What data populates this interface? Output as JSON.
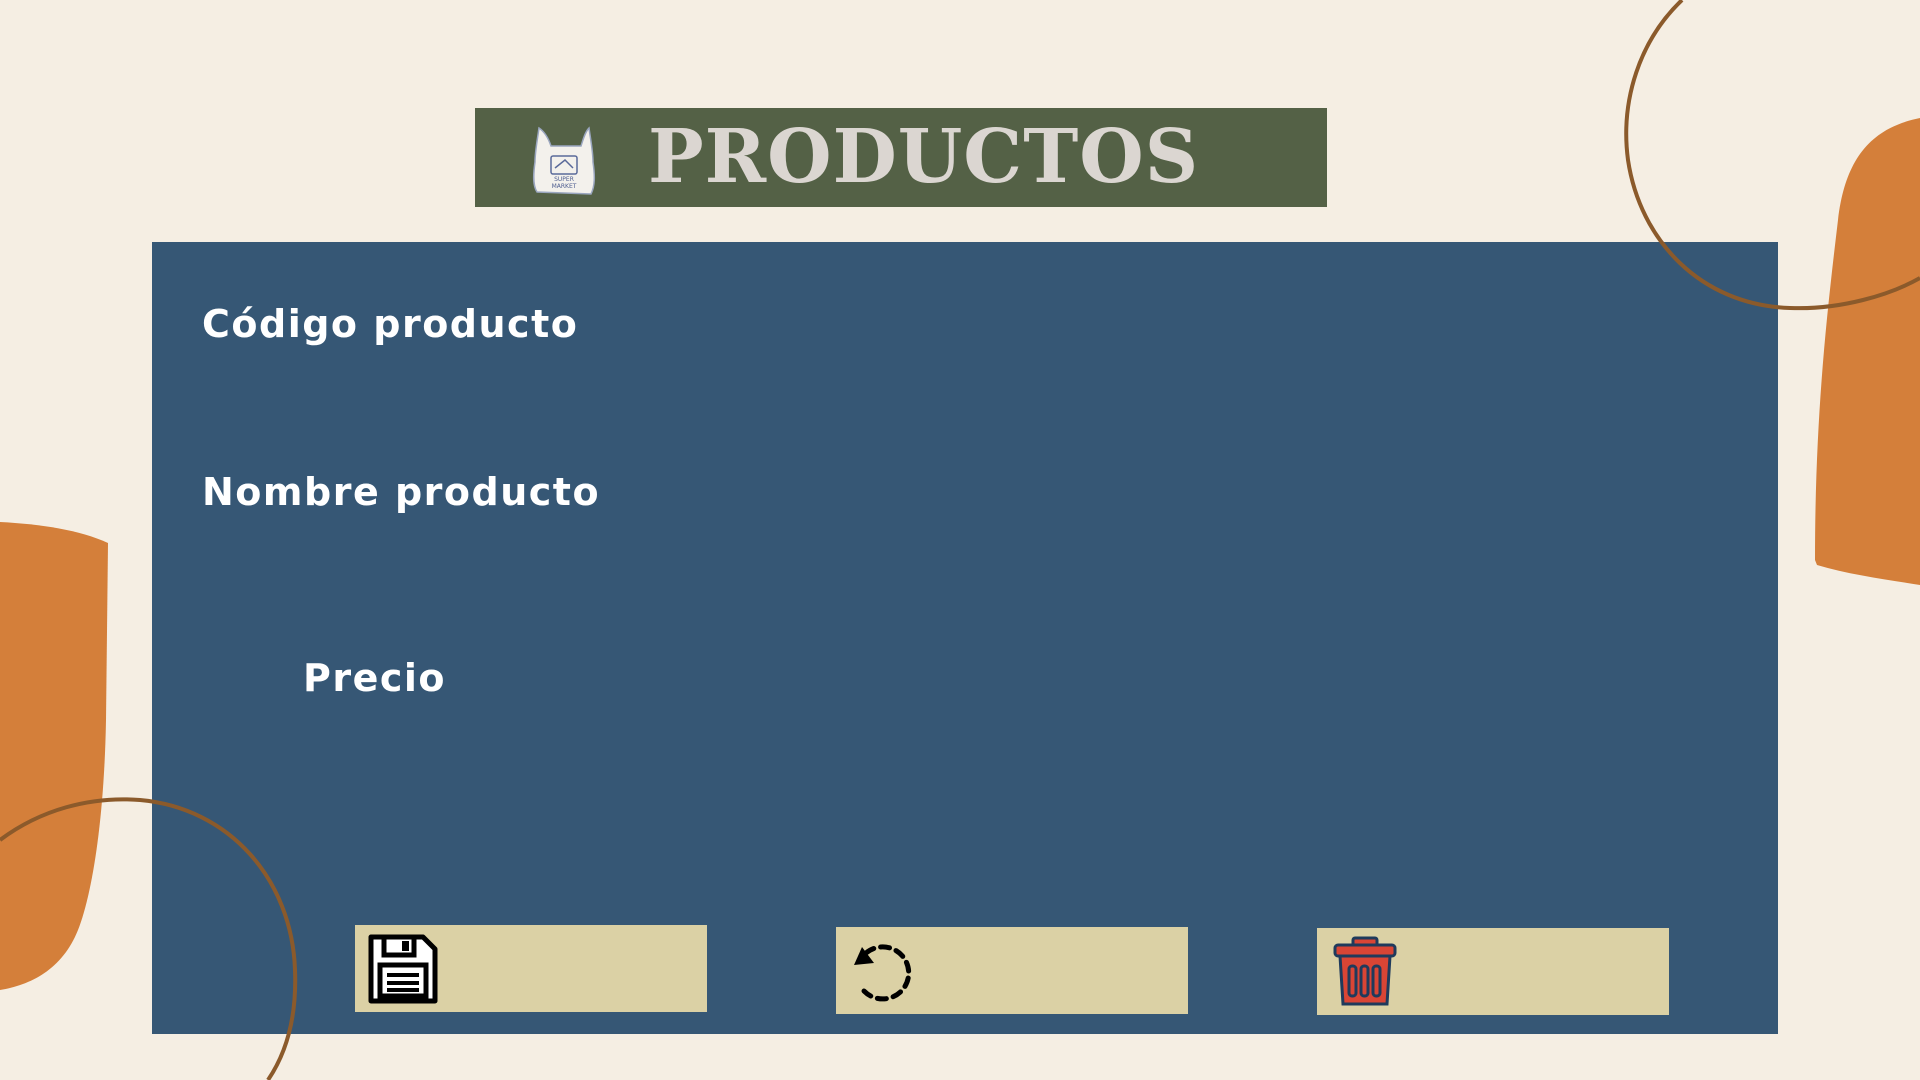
{
  "header": {
    "title": "PRODUCTOS",
    "logo_text_top": "SUPER",
    "logo_text_bottom": "MARKET",
    "logo_icon": "shopping-bag-icon"
  },
  "form": {
    "code_label": "Código producto",
    "name_label": "Nombre producto",
    "price_label": "Precio"
  },
  "actions": [
    {
      "name": "save",
      "icon": "floppy-disk-icon"
    },
    {
      "name": "refresh",
      "icon": "refresh-icon"
    },
    {
      "name": "delete",
      "icon": "trash-icon"
    }
  ],
  "colors": {
    "background": "#f5eee3",
    "header": "#546146",
    "header_text": "#dbd6d1",
    "panel": "#365775",
    "button": "#dbd1a5",
    "accent_orange": "#d47f3a",
    "accent_brown": "#8b5a2b",
    "delete_red": "#d94535"
  }
}
